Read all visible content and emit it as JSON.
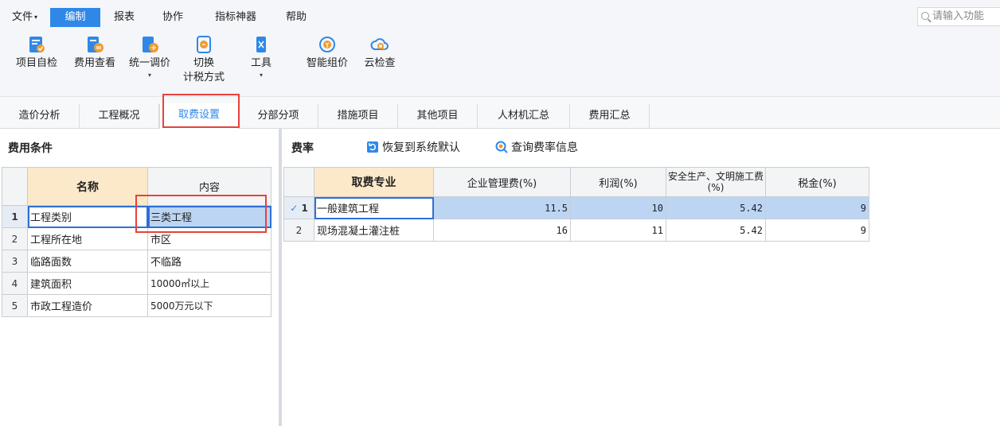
{
  "menu": {
    "items": [
      {
        "label": "文件",
        "has_caret": true,
        "active": false
      },
      {
        "label": "编制",
        "active": true
      },
      {
        "label": "报表",
        "active": false
      },
      {
        "label": "协作",
        "active": false
      },
      {
        "label": "指标神器",
        "active": false
      },
      {
        "label": "帮助",
        "active": false
      }
    ],
    "search_placeholder": "请输入功能"
  },
  "ribbon": {
    "buttons": [
      {
        "label": "项目自检",
        "icon": "project-check-icon"
      },
      {
        "label": "费用查看",
        "icon": "cost-view-icon"
      },
      {
        "label": "统一调价",
        "icon": "unified-price-icon",
        "dropdown": true
      },
      {
        "label": "切换",
        "label2": "计税方式",
        "icon": "switch-tax-icon"
      },
      {
        "label": "工具",
        "icon": "tools-icon",
        "dropdown": true
      },
      {
        "label": "智能组价",
        "icon": "smart-pricing-icon"
      },
      {
        "label": "云检查",
        "icon": "cloud-check-icon"
      }
    ]
  },
  "tabs": [
    "造价分析",
    "工程概况",
    "取费设置",
    "分部分项",
    "措施项目",
    "其他项目",
    "人材机汇总",
    "费用汇总"
  ],
  "active_tab": "取费设置",
  "left_panel": {
    "title": "费用条件",
    "columns": [
      "名称",
      "内容"
    ],
    "rows": [
      {
        "no": "1",
        "name": "工程类别",
        "content": "三类工程"
      },
      {
        "no": "2",
        "name": "工程所在地",
        "content": "市区"
      },
      {
        "no": "3",
        "name": "临路面数",
        "content": "不临路"
      },
      {
        "no": "4",
        "name": "建筑面积",
        "content": "10000㎡以上"
      },
      {
        "no": "5",
        "name": "市政工程造价",
        "content": "5000万元以下"
      }
    ]
  },
  "right_panel": {
    "title": "费率",
    "actions": [
      "恢复到系统默认",
      "查询费率信息"
    ],
    "columns": [
      "取费专业",
      "企业管理费(%)",
      "利润(%)",
      "安全生产、文明施工费(%)",
      "税金(%)"
    ],
    "rows": [
      {
        "no": "1",
        "name": "一般建筑工程",
        "mgmt": "11.5",
        "profit": "10",
        "safety": "5.42",
        "tax": "9"
      },
      {
        "no": "2",
        "name": "现场混凝土灌注桩",
        "mgmt": "16",
        "profit": "11",
        "safety": "5.42",
        "tax": "9"
      }
    ]
  },
  "colors": {
    "accent": "#2f88e8",
    "highlight_box": "#e8413b",
    "header_name_bg": "#fbe9c9",
    "selection_bg": "#bcd5f3"
  }
}
